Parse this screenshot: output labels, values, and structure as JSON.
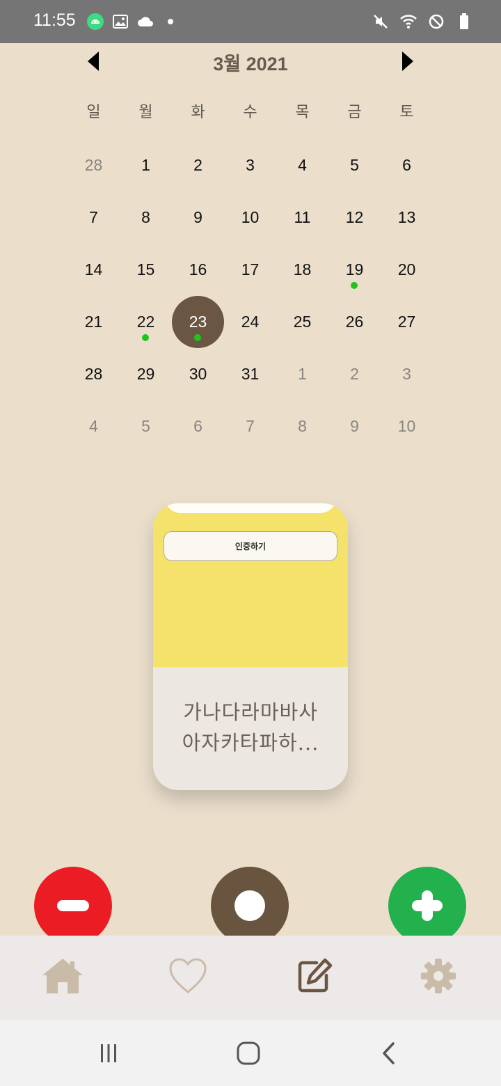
{
  "status_bar": {
    "time": "11:55",
    "left_icons": [
      "android-icon",
      "image-icon",
      "cloud-icon",
      "dot-icon"
    ],
    "right_icons": [
      "mute-icon",
      "wifi-icon",
      "block-icon",
      "battery-icon"
    ]
  },
  "calendar": {
    "month_title": "3월 2021",
    "weekdays": [
      "일",
      "월",
      "화",
      "수",
      "목",
      "금",
      "토"
    ],
    "days": [
      {
        "label": "28",
        "other": true
      },
      {
        "label": "1"
      },
      {
        "label": "2"
      },
      {
        "label": "3"
      },
      {
        "label": "4"
      },
      {
        "label": "5"
      },
      {
        "label": "6"
      },
      {
        "label": "7"
      },
      {
        "label": "8"
      },
      {
        "label": "9"
      },
      {
        "label": "10"
      },
      {
        "label": "11"
      },
      {
        "label": "12"
      },
      {
        "label": "13"
      },
      {
        "label": "14"
      },
      {
        "label": "15"
      },
      {
        "label": "16"
      },
      {
        "label": "17"
      },
      {
        "label": "18"
      },
      {
        "label": "19",
        "dot": true
      },
      {
        "label": "20"
      },
      {
        "label": "21"
      },
      {
        "label": "22",
        "dot": true
      },
      {
        "label": "23",
        "selected": true,
        "dot": true
      },
      {
        "label": "24"
      },
      {
        "label": "25"
      },
      {
        "label": "26"
      },
      {
        "label": "27"
      },
      {
        "label": "28"
      },
      {
        "label": "29"
      },
      {
        "label": "30"
      },
      {
        "label": "31"
      },
      {
        "label": "1",
        "other": true
      },
      {
        "label": "2",
        "other": true
      },
      {
        "label": "3",
        "other": true
      },
      {
        "label": "4",
        "other": true
      },
      {
        "label": "5",
        "other": true
      },
      {
        "label": "6",
        "other": true
      },
      {
        "label": "7",
        "other": true
      },
      {
        "label": "8",
        "other": true
      },
      {
        "label": "9",
        "other": true
      },
      {
        "label": "10",
        "other": true
      }
    ],
    "event_dot_color": "#1FC41F",
    "selected_color": "#6A5642"
  },
  "card": {
    "verify_button_label": "인증하기",
    "text_line1": "가나다라마바사",
    "text_line2": "아자카타파하...",
    "top_color": "#F4E26A"
  },
  "actions": {
    "minus_color": "#EC1C24",
    "circle_color": "#695440",
    "plus_color": "#22B14C"
  },
  "bottom_nav": {
    "items": [
      {
        "name": "home",
        "icon": "home-icon",
        "active": false
      },
      {
        "name": "favorites",
        "icon": "heart-icon",
        "active": false
      },
      {
        "name": "write",
        "icon": "edit-icon",
        "active": true
      },
      {
        "name": "settings",
        "icon": "gear-icon",
        "active": false
      }
    ]
  },
  "system_nav": {
    "buttons": [
      "recent-apps-icon",
      "home-circle-icon",
      "back-icon"
    ]
  }
}
